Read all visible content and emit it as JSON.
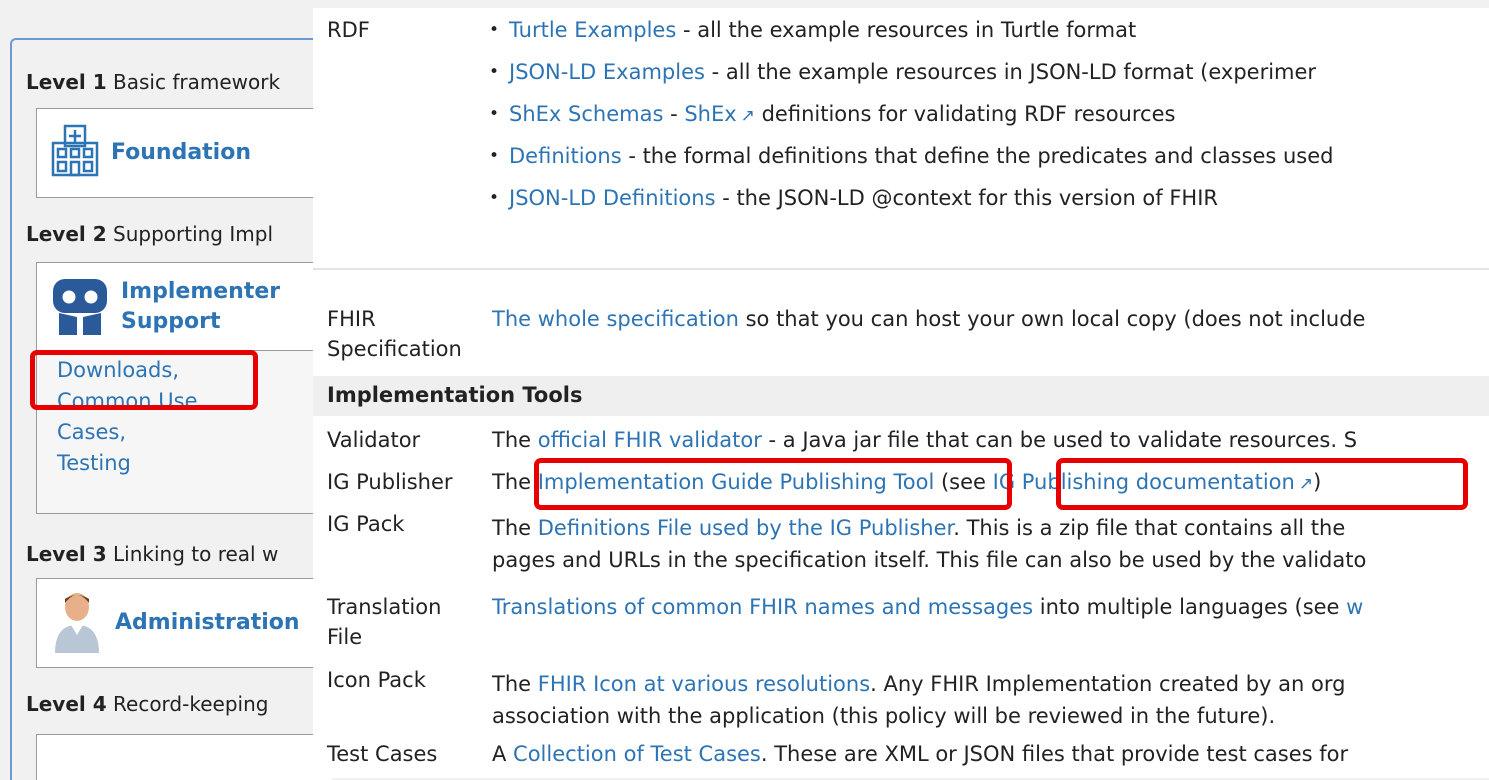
{
  "left": {
    "level1": {
      "label": "Level 1",
      "text": "Basic framework"
    },
    "foundation": {
      "title": "Foundation",
      "icon": "hospital-icon"
    },
    "level2": {
      "label": "Level 2",
      "text": "Supporting Impl"
    },
    "implementer": {
      "title_line1": "Implementer",
      "title_line2": "Support",
      "icon": "people-icon"
    },
    "sublinks": [
      "Downloads,",
      "Common Use",
      "Cases,",
      "Testing"
    ],
    "level3": {
      "label": "Level 3",
      "text": "Linking to real w"
    },
    "administration": {
      "title": "Administration",
      "icon": "person-icon"
    },
    "level4": {
      "label": "Level 4",
      "text": "Record-keeping"
    }
  },
  "rdf": {
    "label": "RDF",
    "items": [
      {
        "link": "Turtle Examples",
        "text": " - all the example resources in Turtle format"
      },
      {
        "link": "JSON-LD Examples",
        "text": " - all the example resources in JSON-LD format (experimer"
      },
      {
        "link": "ShEx Schemas",
        "mid": " - ",
        "link2": "ShEx",
        "text": " definitions for validating RDF resources"
      },
      {
        "link": "Definitions",
        "text": " - the formal definitions that define the predicates and classes used"
      },
      {
        "link": "JSON-LD Definitions",
        "text": " - the JSON-LD @context for this version of FHIR"
      }
    ]
  },
  "fhir_spec": {
    "label_line1": "FHIR",
    "label_line2": "Specification",
    "link": "The whole specification",
    "text": " so that you can host your own local copy (does not include"
  },
  "tools_header": "Implementation Tools",
  "rows": {
    "validator": {
      "label": "Validator",
      "pre": "The ",
      "link": "official FHIR validator",
      "text": " - a Java jar file that can be used to validate resources. S"
    },
    "ig_publisher": {
      "label": "IG Publisher",
      "pre": "The ",
      "link": "Implementation Guide Publishing Tool",
      "mid": " (see ",
      "link2": "IG Publishing documentation",
      "post": ")"
    },
    "ig_pack": {
      "label": "IG Pack",
      "pre": "The ",
      "link": "Definitions File used by the IG Publisher",
      "text": ". This is a zip file that contains all the",
      "line2": "pages and URLs in the specification itself. This file can also be used by the validato"
    },
    "translation": {
      "label_line1": "Translation",
      "label_line2": "File",
      "link": "Translations of common FHIR names and messages",
      "text": " into multiple languages (see ",
      "link2": "w"
    },
    "icon_pack": {
      "label": "Icon Pack",
      "pre": "The ",
      "link": "FHIR Icon at various resolutions",
      "text": ". Any FHIR Implementation created by an org",
      "line2": "association with the application (this policy will be reviewed in the future)."
    },
    "test_cases": {
      "label": "Test Cases",
      "pre": "A ",
      "link": "Collection of Test Cases",
      "text": ". These are XML or JSON files that provide test cases for"
    }
  },
  "colors": {
    "link": "#2d74b5",
    "highlight": "#e60000",
    "panel_border": "#6b9ad3"
  }
}
